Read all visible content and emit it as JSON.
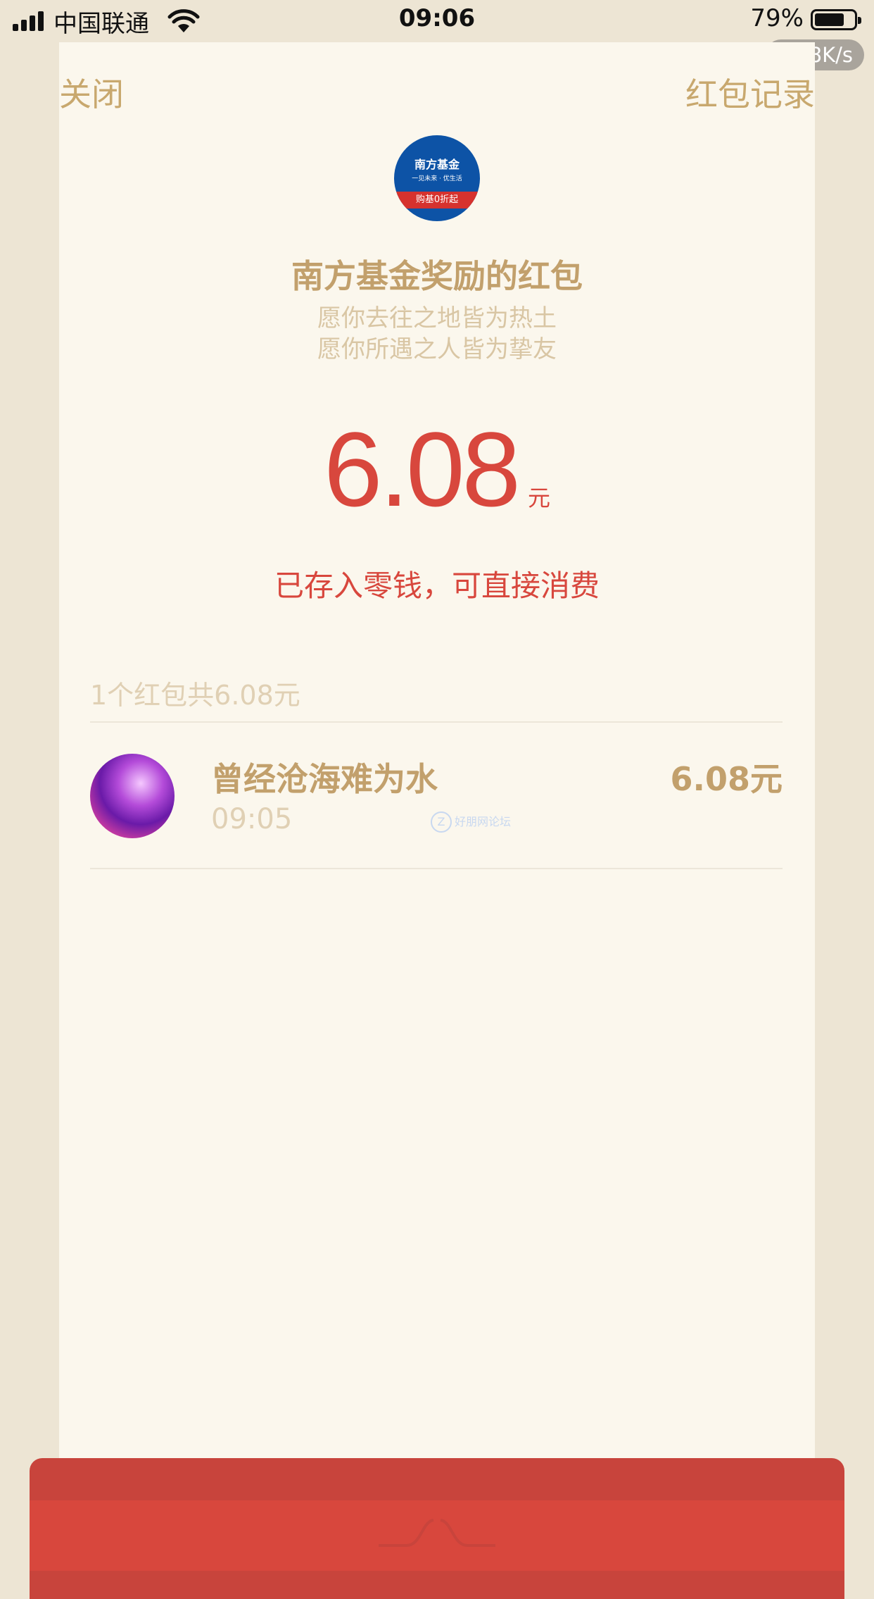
{
  "status_bar": {
    "carrier": "中国联通",
    "time": "09:06",
    "battery_percent": "79%",
    "battery_level": 0.79,
    "net_speed": "5.38K/s"
  },
  "header": {
    "close_label": "关闭",
    "records_label": "红包记录"
  },
  "sender": {
    "logo_text": "南方基金",
    "logo_subtext": "一见未来 · 优生活",
    "logo_ribbon": "购基0折起",
    "title": "南方基金奖励的红包",
    "greeting_line1": "愿你去往之地皆为热土",
    "greeting_line2": "愿你所遇之人皆为挚友"
  },
  "amount": {
    "value": "6.08",
    "unit": "元",
    "note": "已存入零钱，可直接消费"
  },
  "list": {
    "summary": "1个红包共6.08元",
    "items": [
      {
        "name": "曾经沧海难为水",
        "time": "09:05",
        "amount": "6.08元"
      }
    ],
    "watermark": "好朋网论坛"
  },
  "colors": {
    "page_bg": "#ede5d4",
    "card_bg": "#fbf7ed",
    "gold": "#c2a06c",
    "red": "#d8473d"
  }
}
